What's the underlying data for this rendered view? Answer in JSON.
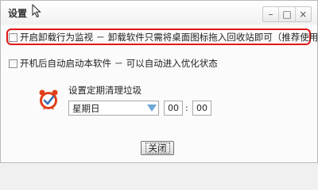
{
  "window": {
    "title": "设置",
    "controls": {
      "minimize": "–",
      "maximize": "□",
      "close": "×"
    }
  },
  "options": [
    {
      "label": "开启卸载行为监视 － 卸载软件只需将桌面图标拖入回收站即可（推荐使用）",
      "checked": false,
      "highlighted": true
    },
    {
      "label": "开机后自动启动本软件 － 可以自动进入优化状态",
      "checked": false,
      "highlighted": false
    }
  ],
  "schedule": {
    "label": "设置定期清理垃圾",
    "day": "星期日",
    "hour": "00",
    "colon": ":",
    "minute": "00"
  },
  "footer": {
    "close_label": "关闭"
  },
  "colors": {
    "highlight": "#e01818",
    "arrow": "#6fa7d6",
    "clock": "#e0401a"
  }
}
